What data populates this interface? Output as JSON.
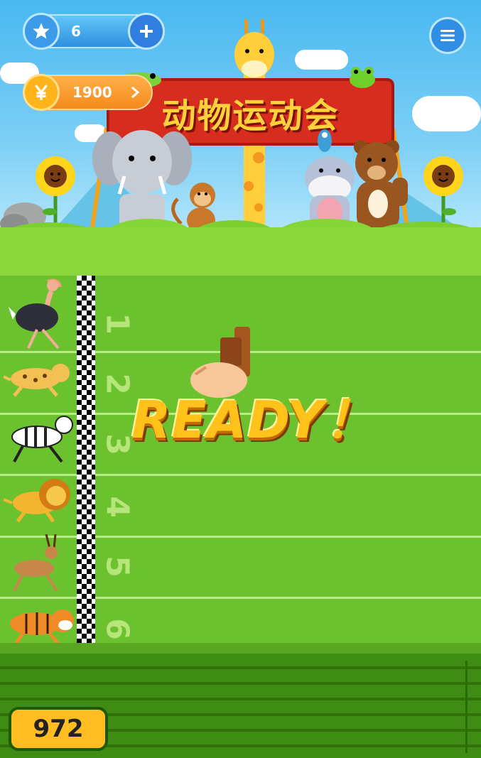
{
  "hud": {
    "stars": "6",
    "coins": "1900"
  },
  "banner": {
    "title": "动物运动会"
  },
  "lanes": [
    {
      "number": "1",
      "animal": "ostrich"
    },
    {
      "number": "2",
      "animal": "cheetah"
    },
    {
      "number": "3",
      "animal": "zebra"
    },
    {
      "number": "4",
      "animal": "lion"
    },
    {
      "number": "5",
      "animal": "gazelle"
    },
    {
      "number": "6",
      "animal": "tiger"
    }
  ],
  "status": {
    "ready_text": "READY！"
  },
  "score": {
    "value": "972"
  },
  "colors": {
    "grass": "#6cc12e",
    "lane_line": "#b9ec86",
    "banner": "#d62d1f",
    "banner_text": "#ffd23c",
    "ready": "#ffc21a",
    "score_box": "#ffbd22"
  },
  "icons": {
    "star": "star-icon",
    "plus": "plus-icon",
    "menu": "menu-icon",
    "coin": "yen-coin-icon",
    "next": "chevron-right-icon"
  }
}
